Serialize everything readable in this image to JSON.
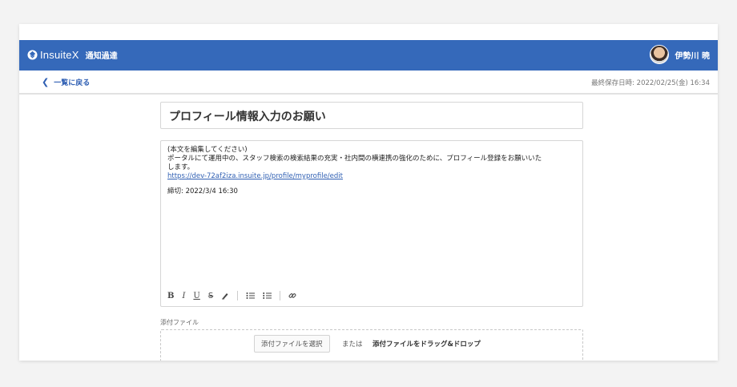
{
  "header": {
    "brand": "InsuiteX",
    "app_name": "通知過達",
    "user_name": "伊勢川 暁",
    "bg_color": "#3569ba"
  },
  "subbar": {
    "back_label": "一覧に戻る",
    "last_saved": "最終保存日時: 2022/02/25(金) 16:34"
  },
  "editor": {
    "title": "プロフィール情報入力のお願い",
    "body_lines": [
      "(本文を編集してください)",
      "ポータルにて運用中の、スタッフ検索の検索結果の充実・社内間の横連携の強化のために、プロフィール登録をお願いいた",
      "します。"
    ],
    "link": "https://dev-72af2iza.insuite.jp/profile/myprofile/edit",
    "deadline": "締切: 2022/3/4 16:30",
    "toolbar": {
      "bold": "B",
      "italic": "I",
      "underline": "U",
      "strike": "S"
    }
  },
  "attachments": {
    "label": "添付ファイル",
    "select_button": "添付ファイルを選択",
    "or_text": "または",
    "drop_text": "添付ファイルをドラッグ&ドロップ"
  },
  "icons": [
    "logo-icon",
    "avatar",
    "chevron-left-icon",
    "bold-icon",
    "italic-icon",
    "underline-icon",
    "strike-icon",
    "highlight-icon",
    "bullet-list-icon",
    "numbered-list-icon",
    "link-icon"
  ]
}
